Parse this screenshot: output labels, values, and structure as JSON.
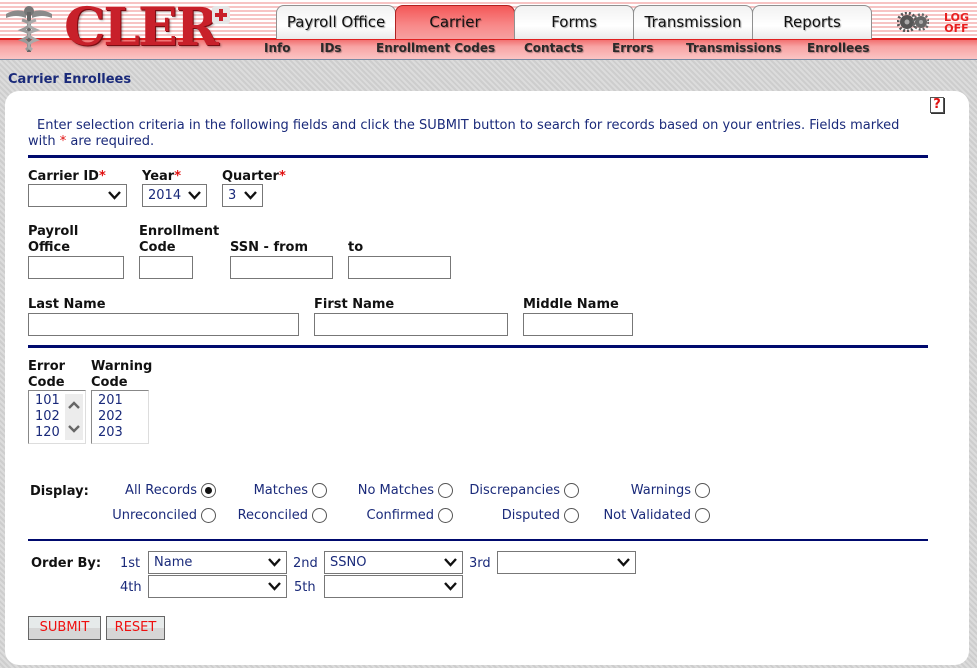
{
  "app": {
    "logo_text": "CLER",
    "tabs": [
      {
        "label": "Payroll Office",
        "active": false
      },
      {
        "label": "Carrier",
        "active": true
      },
      {
        "label": "Forms",
        "active": false
      },
      {
        "label": "Transmission",
        "active": false
      },
      {
        "label": "Reports",
        "active": false
      }
    ],
    "subnav": [
      "Info",
      "IDs",
      "Enrollment Codes",
      "Contacts",
      "Errors",
      "Transmissions",
      "Enrollees"
    ],
    "logoff_line1": "LOG",
    "logoff_line2": "OFF"
  },
  "page": {
    "title": "Carrier Enrollees",
    "help_glyph": "?",
    "intro_text": "Enter selection criteria in the following fields and click the SUBMIT button to search for records based on your entries.  Fields marked with ",
    "intro_required_mark": "*",
    "intro_suffix": " are required."
  },
  "form": {
    "required_mark": "*",
    "carrier_id": {
      "label": "Carrier ID",
      "value": ""
    },
    "year": {
      "label": "Year",
      "value": "2014"
    },
    "quarter": {
      "label": "Quarter",
      "value": "3"
    },
    "payroll_office": {
      "label_line1": "Payroll",
      "label_line2": "Office",
      "value": ""
    },
    "enrollment_code": {
      "label_line1": "Enrollment",
      "label_line2": "Code",
      "value": ""
    },
    "ssn_from": {
      "label": "SSN - from",
      "value": ""
    },
    "ssn_to": {
      "label": "to",
      "value": ""
    },
    "last_name": {
      "label": "Last Name",
      "value": ""
    },
    "first_name": {
      "label": "First Name",
      "value": ""
    },
    "middle_name": {
      "label": "Middle Name",
      "value": ""
    },
    "error_code": {
      "label_line1": "Error",
      "label_line2": "Code",
      "options": [
        "101",
        "102",
        "120"
      ]
    },
    "warning_code": {
      "label_line1": "Warning",
      "label_line2": "Code",
      "options": [
        "201",
        "202",
        "203"
      ]
    },
    "display": {
      "label": "Display:",
      "options": [
        {
          "label": "All Records",
          "checked": true
        },
        {
          "label": "Matches",
          "checked": false
        },
        {
          "label": "No Matches",
          "checked": false
        },
        {
          "label": "Discrepancies",
          "checked": false
        },
        {
          "label": "Warnings",
          "checked": false
        },
        {
          "label": "Unreconciled",
          "checked": false
        },
        {
          "label": "Reconciled",
          "checked": false
        },
        {
          "label": "Confirmed",
          "checked": false
        },
        {
          "label": "Disputed",
          "checked": false
        },
        {
          "label": "Not Validated",
          "checked": false
        }
      ]
    },
    "order_by": {
      "label": "Order By:",
      "fields": [
        {
          "ordinal": "1st",
          "value": "Name"
        },
        {
          "ordinal": "2nd",
          "value": "SSNO"
        },
        {
          "ordinal": "3rd",
          "value": ""
        },
        {
          "ordinal": "4th",
          "value": ""
        },
        {
          "ordinal": "5th",
          "value": ""
        }
      ]
    },
    "submit_label": "SUBMIT",
    "reset_label": "RESET"
  }
}
